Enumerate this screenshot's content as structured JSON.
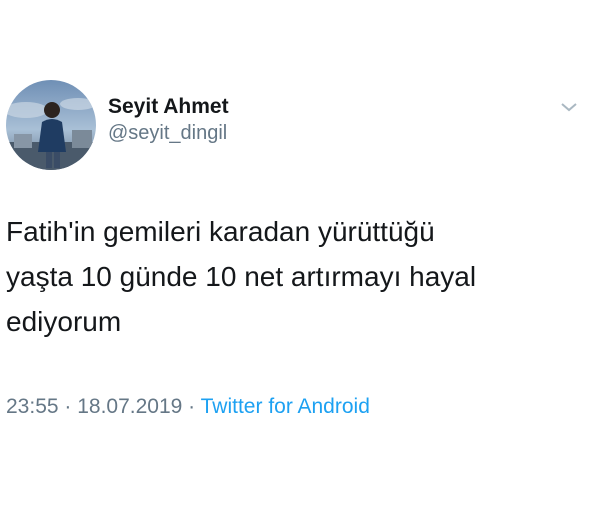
{
  "user": {
    "display_name": "Seyit Ahmet",
    "handle": "@seyit_dingil"
  },
  "tweet": {
    "text": "Fatih'in gemileri karadan yürüttüğü\nyaşta 10 günde 10 net artırmayı hayal\nediyorum",
    "time": "23:55",
    "separator": " · ",
    "date": "18.07.2019",
    "separator2": " · ",
    "source": "Twitter for Android"
  },
  "icons": {
    "menu": "chevron-down-icon"
  },
  "colors": {
    "text": "#14171a",
    "secondary": "#657786",
    "link": "#1da1f2",
    "background": "#ffffff"
  }
}
